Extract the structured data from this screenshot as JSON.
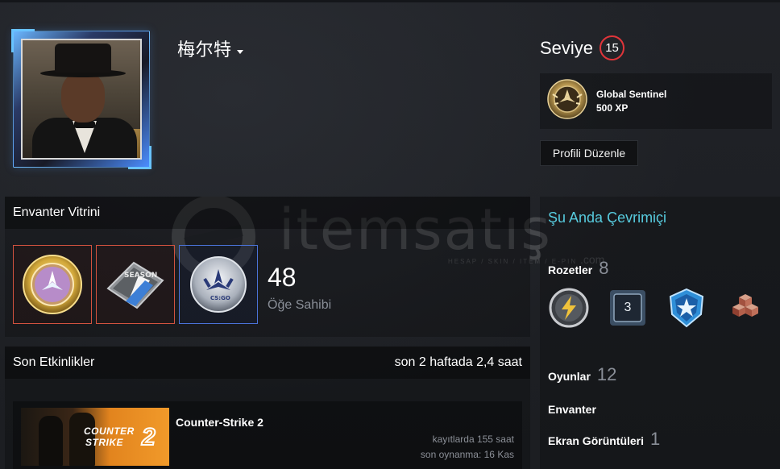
{
  "profile": {
    "name": "梅尔特",
    "level_label": "Seviye",
    "level": "15",
    "favorite_badge": {
      "name": "Global Sentinel",
      "xp": "500 XP"
    },
    "edit_button": "Profili Düzenle"
  },
  "showcase": {
    "title": "Envanter Vitrini",
    "count": "48",
    "count_label": "Öğe Sahibi",
    "items": [
      {
        "icon": "badge-coin-icon",
        "border": "#d2523f"
      },
      {
        "icon": "season-pin-icon",
        "border": "#d2523f"
      },
      {
        "icon": "csgo-coin-icon",
        "border": "#4a72d8"
      }
    ]
  },
  "recent": {
    "title": "Son Etkinlikler",
    "summary": "son 2 haftada 2,4 saat",
    "games": [
      {
        "name": "Counter-Strike 2",
        "hours_on_record": "kayıtlarda 155 saat",
        "last_played": "son oynanma: 16 Kas",
        "capsule_line1": "COUNTER",
        "capsule_line2": "STRIKE",
        "capsule_number": "2"
      }
    ]
  },
  "sidebar": {
    "status": "Şu Anda Çevrimiçi",
    "badges_label": "Rozetler",
    "badges_count": "8",
    "badge_icons": [
      "lightning-badge-icon",
      "number-3-badge-icon",
      "star-shield-badge-icon",
      "cubes-badge-icon"
    ],
    "badge_3_label": "3",
    "games_label": "Oyunlar",
    "games_count": "12",
    "inventory_label": "Envanter",
    "screenshots_label": "Ekran Görüntüleri",
    "screenshots_count": "1"
  },
  "watermark": {
    "text": "itemsatış",
    "sub": "HESAP / SKIN / ITEM / E-PIN",
    "dotcom": ".com"
  },
  "colors": {
    "accent_status": "#57cbde",
    "level_ring": "#e0353a",
    "item_border_red": "#d2523f",
    "item_border_blue": "#4a72d8"
  }
}
